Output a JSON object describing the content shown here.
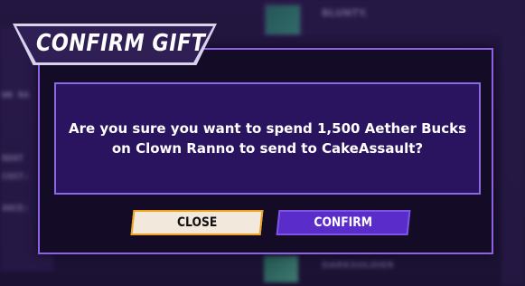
{
  "background": {
    "left_labels": [
      "WN RA",
      "RENT",
      "COST:",
      "ANCE:"
    ],
    "top_right_name": "BLUNTY.",
    "bottom_right_name": "DARKSOLDIER"
  },
  "dialog": {
    "title": "CONFIRM GIFT",
    "message": "Are you sure you want to spend 1,500 Aether Bucks on Clown Ranno to send to CakeAssault?",
    "close_label": "CLOSE",
    "confirm_label": "CONFIRM"
  },
  "colors": {
    "accent_purple": "#5a2cc9",
    "border_purple": "#8d62e8",
    "close_border_orange": "#f0a11e",
    "close_fill": "#f3e8dc"
  }
}
